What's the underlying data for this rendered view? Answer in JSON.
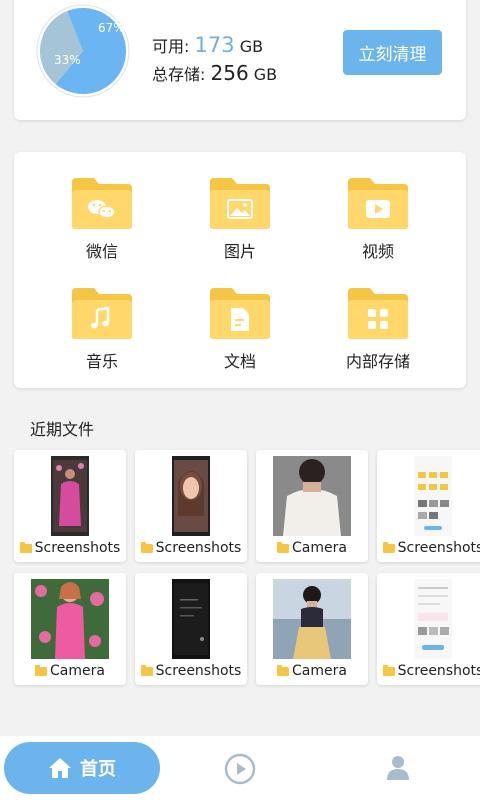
{
  "storage": {
    "available_label": "可用:",
    "available_value": "173",
    "available_unit": "GB",
    "total_label": "总存储:",
    "total_value": "256",
    "total_unit": "GB",
    "pie_used_label": "67%",
    "pie_free_label": "33%",
    "pie_used_fraction": 0.67,
    "clean_button": "立刻清理"
  },
  "categories": [
    {
      "label": "微信",
      "icon": "wechat-icon"
    },
    {
      "label": "图片",
      "icon": "image-icon"
    },
    {
      "label": "视频",
      "icon": "video-icon"
    },
    {
      "label": "音乐",
      "icon": "music-icon"
    },
    {
      "label": "文档",
      "icon": "document-icon"
    },
    {
      "label": "内部存储",
      "icon": "grid-icon"
    }
  ],
  "recent": {
    "title": "近期文件",
    "files": [
      {
        "folder": "Screenshots"
      },
      {
        "folder": "Screenshots"
      },
      {
        "folder": "Camera"
      },
      {
        "folder": "Screenshots"
      },
      {
        "folder": "Camera"
      },
      {
        "folder": "Screenshots"
      },
      {
        "folder": "Camera"
      },
      {
        "folder": "Screenshots"
      }
    ]
  },
  "nav": {
    "home_label": "首页",
    "home_icon": "home-icon",
    "play_icon": "play-circle-icon",
    "profile_icon": "person-icon"
  },
  "colors": {
    "accent": "#6cb4ec",
    "pie_used": "#6ab5f2",
    "pie_free": "#a6c4d8",
    "folder": "#f5c646",
    "folder_light": "#ffd76a"
  }
}
